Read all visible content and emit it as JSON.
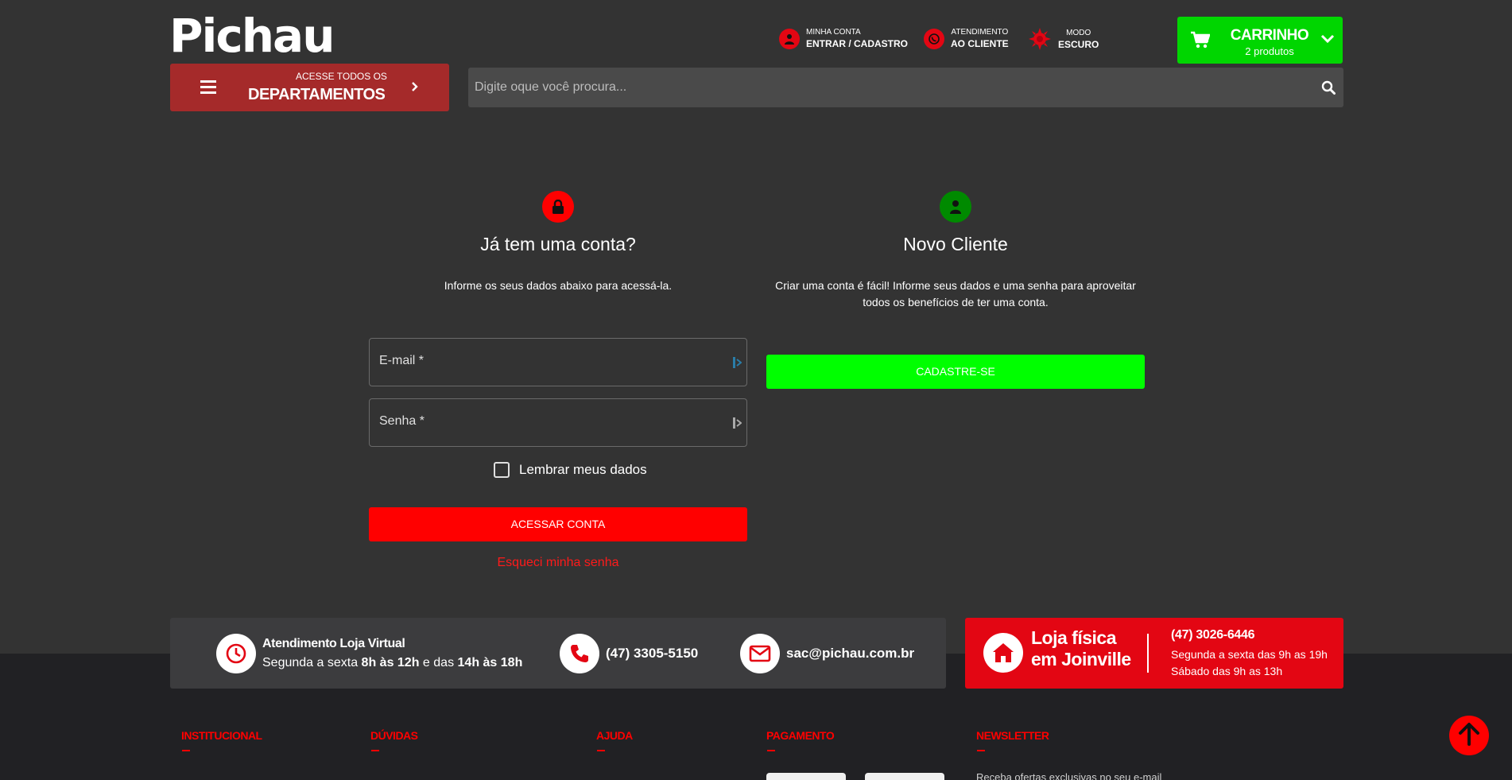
{
  "header": {
    "logo": "Pichau",
    "account": {
      "small": "MINHA CONTA",
      "big": "ENTRAR / CADASTRO"
    },
    "support": {
      "small": "ATENDIMENTO",
      "big": "AO CLIENTE"
    },
    "mode": {
      "small": "MODO",
      "big": "ESCURO"
    },
    "cart": {
      "title": "CARRINHO",
      "subtitle": "2 produtos"
    },
    "departments": {
      "small": "ACESSE TODOS OS",
      "big": "DEPARTAMENTOS"
    },
    "search": {
      "placeholder": "Digite oque você procura..."
    }
  },
  "login": {
    "title": "Já tem uma conta?",
    "description": "Informe os seus dados abaixo para acessá-la.",
    "email_label": "E-mail *",
    "password_label": "Senha *",
    "remember_label": "Lembrar meus dados",
    "submit_label": "ACESSAR CONTA",
    "forgot_label": "Esqueci minha senha"
  },
  "register": {
    "title": "Novo Cliente",
    "description": "Criar uma conta é fácil! Informe seus dados e uma senha para aproveitar todos os benefícios de ter uma conta.",
    "button_label": "CADASTRE-SE"
  },
  "info_bar": {
    "hours_title": "Atendimento Loja Virtual",
    "hours_prefix": "Segunda a sexta ",
    "hours_a": "8h às 12h",
    "hours_mid": " e das ",
    "hours_b": "14h às 18h",
    "phone": "(47) 3305-5150",
    "email": "sac@pichau.com.br"
  },
  "store": {
    "title_line1": "Loja física",
    "title_line2": "em Joinville",
    "phone": "(47) 3026-6446",
    "hours_line1": "Segunda a sexta das 9h as 19h",
    "hours_line2": "Sábado das 9h as 13h"
  },
  "footer": {
    "headings": [
      "INSTITUCIONAL",
      "DÚVIDAS",
      "AJUDA",
      "PAGAMENTO",
      "NEWSLETTER"
    ],
    "newsletter_text": "Receba ofertas exclusivas no seu e-mail"
  },
  "colors": {
    "background": "#333333",
    "brand_red": "#e30613",
    "cart_green": "#00d600",
    "register_green": "#00ff00",
    "login_red": "#ff0000"
  },
  "icons": [
    "user-icon",
    "whatsapp-icon",
    "sun-icon",
    "cart-icon",
    "chevron-down-icon",
    "menu-icon",
    "chevron-right-icon",
    "search-icon",
    "lock-icon",
    "key-icon",
    "clock-icon",
    "phone-icon",
    "mail-icon",
    "home-icon",
    "arrow-up-icon"
  ]
}
